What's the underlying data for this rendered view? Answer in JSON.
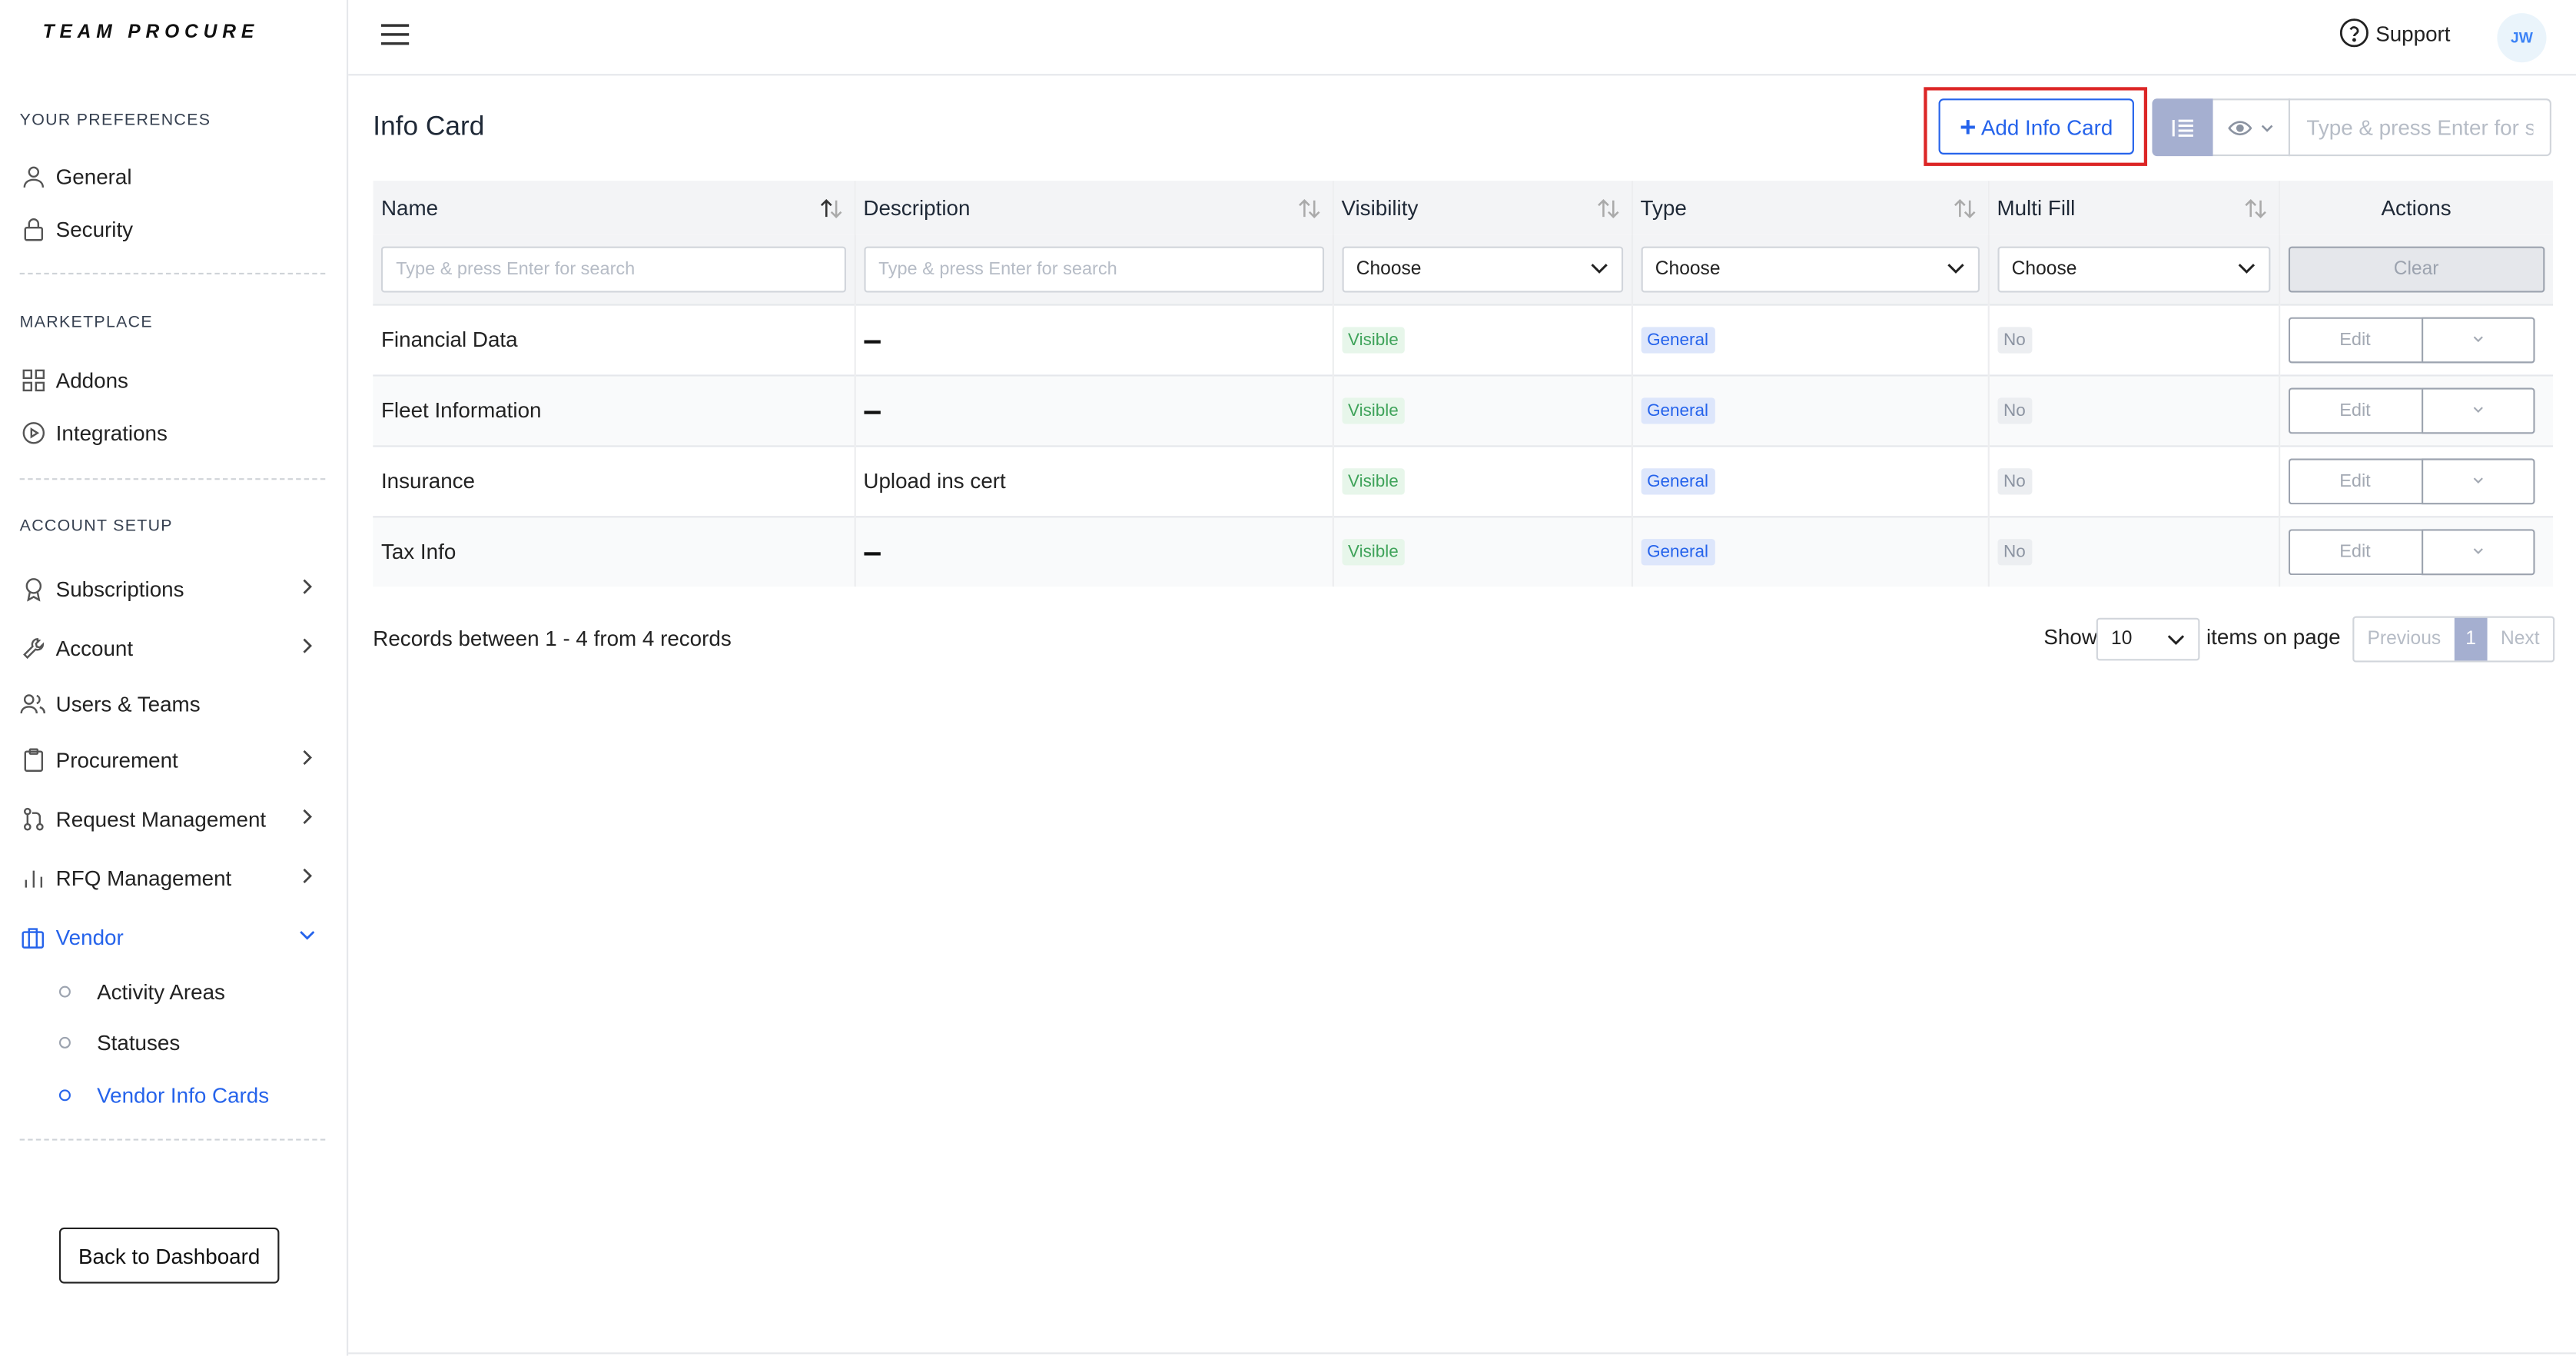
{
  "app": {
    "logo": "TEAM PROCURE"
  },
  "sidebar": {
    "sections": [
      {
        "title": "YOUR PREFERENCES"
      },
      {
        "title": "MARKETPLACE"
      },
      {
        "title": "ACCOUNT SETUP"
      }
    ],
    "items": [
      {
        "label": "General",
        "icon": "user-icon"
      },
      {
        "label": "Security",
        "icon": "lock-icon"
      },
      {
        "label": "Addons",
        "icon": "grid-icon"
      },
      {
        "label": "Integrations",
        "icon": "play-circle-icon"
      },
      {
        "label": "Subscriptions",
        "icon": "award-icon",
        "expandable": true
      },
      {
        "label": "Account",
        "icon": "wrench-icon",
        "expandable": true
      },
      {
        "label": "Users & Teams",
        "icon": "users-icon"
      },
      {
        "label": "Procurement",
        "icon": "clipboard-icon",
        "expandable": true
      },
      {
        "label": "Request Management",
        "icon": "git-pull-icon",
        "expandable": true
      },
      {
        "label": "RFQ Management",
        "icon": "bar-chart-icon",
        "expandable": true
      },
      {
        "label": "Vendor",
        "icon": "briefcase-icon",
        "expanded": true,
        "active": true
      }
    ],
    "subitems": [
      {
        "label": "Activity Areas"
      },
      {
        "label": "Statuses"
      },
      {
        "label": "Vendor Info Cards",
        "active": true
      }
    ],
    "back_button": "Back to Dashboard"
  },
  "topbar": {
    "support_label": "Support",
    "avatar_initials": "JW"
  },
  "main": {
    "title": "Info Card",
    "add_button": "Add Info Card",
    "search_placeholder": "Type & press Enter for s",
    "columns": [
      "Name",
      "Description",
      "Visibility",
      "Type",
      "Multi Fill",
      "Actions"
    ],
    "filters": {
      "name_placeholder": "Type & press Enter for search",
      "description_placeholder": "Type & press Enter for search",
      "visibility": "Choose",
      "type": "Choose",
      "multi_fill": "Choose",
      "clear": "Clear"
    },
    "rows": [
      {
        "name": "Financial Data",
        "description": "",
        "visibility": "Visible",
        "type": "General",
        "multi_fill": "No",
        "edit": "Edit"
      },
      {
        "name": "Fleet Information",
        "description": "",
        "visibility": "Visible",
        "type": "General",
        "multi_fill": "No",
        "edit": "Edit"
      },
      {
        "name": "Insurance",
        "description": "Upload ins cert",
        "visibility": "Visible",
        "type": "General",
        "multi_fill": "No",
        "edit": "Edit"
      },
      {
        "name": "Tax Info",
        "description": "",
        "visibility": "Visible",
        "type": "General",
        "multi_fill": "No",
        "edit": "Edit"
      }
    ],
    "footer": {
      "records_text": "Records between 1 - 4 from 4 records",
      "show_label": "Show",
      "page_size": "10",
      "items_label": "items on page",
      "previous": "Previous",
      "current_page": "1",
      "next": "Next"
    }
  },
  "colors": {
    "accent": "#2563eb",
    "highlight": "#dc2626",
    "visible": "#3fa35a",
    "general": "#2563eb"
  }
}
